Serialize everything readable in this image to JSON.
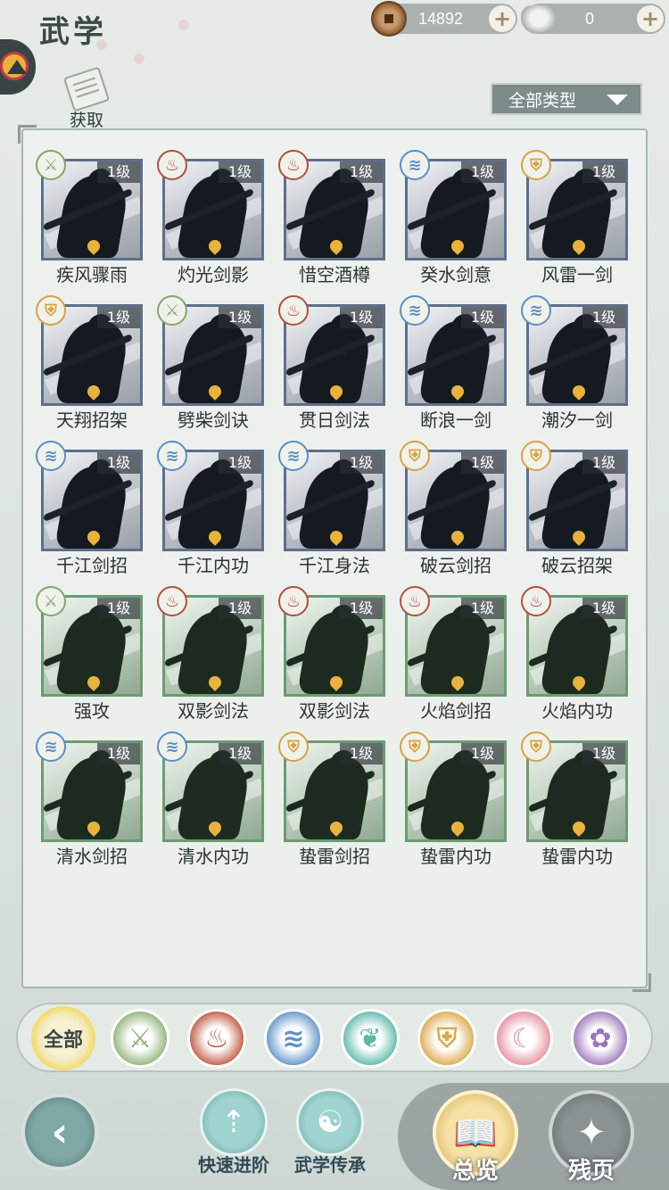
{
  "header": {
    "title": "武学",
    "copper_value": "14892",
    "silver_value": "0",
    "acquire_label": "获取",
    "type_filter": "全部类型"
  },
  "level_label": "1级",
  "skills": [
    {
      "name": "疾风骤雨",
      "sect": "green",
      "glyph": "⚔",
      "tone": "blue"
    },
    {
      "name": "灼光剑影",
      "sect": "red",
      "glyph": "♨",
      "tone": "blue"
    },
    {
      "name": "惜空酒樽",
      "sect": "red",
      "glyph": "♨",
      "tone": "blue"
    },
    {
      "name": "癸水剑意",
      "sect": "blue",
      "glyph": "≋",
      "tone": "blue"
    },
    {
      "name": "风雷一剑",
      "sect": "gold",
      "glyph": "⛨",
      "tone": "blue"
    },
    {
      "name": "天翔招架",
      "sect": "gold",
      "glyph": "⛨",
      "tone": "blue"
    },
    {
      "name": "劈柴剑诀",
      "sect": "green",
      "glyph": "⚔",
      "tone": "blue"
    },
    {
      "name": "贯日剑法",
      "sect": "red",
      "glyph": "♨",
      "tone": "blue"
    },
    {
      "name": "断浪一剑",
      "sect": "blue",
      "glyph": "≋",
      "tone": "blue"
    },
    {
      "name": "潮汐一剑",
      "sect": "blue",
      "glyph": "≋",
      "tone": "blue"
    },
    {
      "name": "千江剑招",
      "sect": "blue",
      "glyph": "≋",
      "tone": "blue"
    },
    {
      "name": "千江内功",
      "sect": "blue",
      "glyph": "≋",
      "tone": "blue"
    },
    {
      "name": "千江身法",
      "sect": "blue",
      "glyph": "≋",
      "tone": "blue"
    },
    {
      "name": "破云剑招",
      "sect": "gold",
      "glyph": "⛨",
      "tone": "blue"
    },
    {
      "name": "破云招架",
      "sect": "gold",
      "glyph": "⛨",
      "tone": "blue"
    },
    {
      "name": "强攻",
      "sect": "green",
      "glyph": "⚔",
      "tone": "green"
    },
    {
      "name": "双影剑法",
      "sect": "red",
      "glyph": "♨",
      "tone": "green"
    },
    {
      "name": "双影剑法",
      "sect": "red",
      "glyph": "♨",
      "tone": "green"
    },
    {
      "name": "火焰剑招",
      "sect": "red",
      "glyph": "♨",
      "tone": "green"
    },
    {
      "name": "火焰内功",
      "sect": "red",
      "glyph": "♨",
      "tone": "green"
    },
    {
      "name": "清水剑招",
      "sect": "blue",
      "glyph": "≋",
      "tone": "green"
    },
    {
      "name": "清水内功",
      "sect": "blue",
      "glyph": "≋",
      "tone": "green"
    },
    {
      "name": "蛰雷剑招",
      "sect": "gold",
      "glyph": "⛨",
      "tone": "green"
    },
    {
      "name": "蛰雷内功",
      "sect": "gold",
      "glyph": "⛨",
      "tone": "green"
    },
    {
      "name": "蛰雷内功",
      "sect": "gold",
      "glyph": "⛨",
      "tone": "green"
    }
  ],
  "sect_colors": {
    "green": "#7fa86c",
    "red": "#b4503a",
    "blue": "#5a8fc4",
    "gold": "#d6a23e"
  },
  "sect_filters": [
    {
      "name": "all",
      "label": "全部",
      "color": "#e6d98c",
      "glyph": ""
    },
    {
      "name": "green-sect",
      "label": "",
      "color": "#8fb276",
      "glyph": "⚔"
    },
    {
      "name": "red-sect",
      "label": "",
      "color": "#c0573f",
      "glyph": "♨"
    },
    {
      "name": "blue-sect",
      "label": "",
      "color": "#5f93c8",
      "glyph": "≋"
    },
    {
      "name": "teal-sect",
      "label": "",
      "color": "#5cb8a8",
      "glyph": "❦"
    },
    {
      "name": "gold-sect",
      "label": "",
      "color": "#dca84a",
      "glyph": "⛨"
    },
    {
      "name": "pink-sect",
      "label": "",
      "color": "#e58f9e",
      "glyph": "☾"
    },
    {
      "name": "purple-sect",
      "label": "",
      "color": "#9b76b8",
      "glyph": "✿"
    }
  ],
  "bottom": {
    "quick_advance": "快速进阶",
    "inherit": "武学传承",
    "overview": "总览",
    "fragments": "残页"
  }
}
